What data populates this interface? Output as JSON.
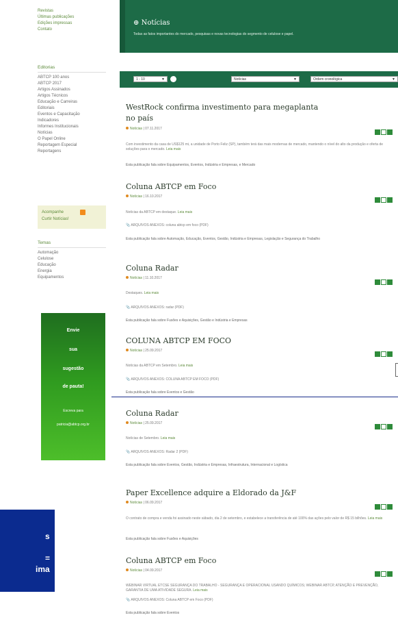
{
  "sidebar": {
    "top_links": [
      "Revistas",
      "Últimas publicações",
      "Edições impressas",
      "Contato"
    ],
    "editorias_title": "Editorias",
    "editorias": [
      "ABTCP 100 anos",
      "ABTCP 2017",
      "Artigos Assinados",
      "Artigos Técnicos",
      "Educação e Carreiras",
      "Editoriais",
      "Eventos e Capacitação",
      "Indicadores",
      "Informes Institucionais",
      "Notícias",
      "O Papel Online",
      "Reportagem Especial",
      "Reportagens"
    ],
    "follow_line1": "Acompanhe",
    "follow_line2": "Curtir Notícias!",
    "temas_title": "Temas",
    "temas": [
      "Automação",
      "Celulose",
      "Educação",
      "Energia",
      "Equipamentos"
    ]
  },
  "promo": {
    "line1": "Envie",
    "line2": "sua",
    "line3": "sugestão",
    "line4": "de pauta!",
    "small1": "Escreva para",
    "small2": "patricia@abtcp.org.br"
  },
  "blue_box": {
    "t1": "s",
    "t2": "=",
    "t3": "ima"
  },
  "header": {
    "title": "Notícias",
    "desc": "Todas as fatos importantes do mercado, pesquisas e novas tecnologias do segmento de celulose e papel."
  },
  "filters": {
    "per_page": "1 - 10",
    "category": "Notícias",
    "order": "Ordem cronológica"
  },
  "colors": {
    "header_bg": "#1d6b47",
    "accent": "#5c8a3a",
    "promo": "#2f9a1f",
    "blue": "#0b2b8f"
  },
  "posts": [
    {
      "title1": "WestRock confirma investimento para megaplanta",
      "title2": "no país",
      "category": "Notícias",
      "date": "| 07.11.2017",
      "body": "Com investimento da casa de US$125 mi, a unidade de Porto Feliz (SP), também terá das mais modernas de mercado, mantendo o nível do alto da produção e oferta de soluções para o mercado.",
      "more": "Leia mais",
      "tags": "Esta publicação fala sobre Equipamentos, Eventos, Indústria e Empresas, e Mercado"
    },
    {
      "title1": "Coluna ABTCP em Foco",
      "category": "Notícias",
      "date": "| 16.10.2017",
      "body": "Notícias da ABTCP em destaque.",
      "more": "Leia mais",
      "attach": "ARQUIVOS ANEXOS: coluna abtcp em foco (PDF)",
      "tags": "Esta publicação fala sobre Automação, Educação, Eventos, Gestão, Indústria e Empresas, Legislação e Segurança do Trabalho"
    },
    {
      "title1": "Coluna Radar",
      "category": "Notícias",
      "date": "| 11.10.2017",
      "body": "Destaques.",
      "more": "Leia mais",
      "attach": "ARQUIVOS ANEXOS: radar (PDF)",
      "tags": "Esta publicação fala sobre Fusões e Aquisições, Gestão e Indústria e Empresas"
    },
    {
      "title1": "COLUNA ABTCP EM FOCO",
      "category": "Notícias",
      "date": "| 25.09.2017",
      "body": "Notícias da ABTCP em Setembro.",
      "more": "Leia mais",
      "attach": "ARQUIVOS ANEXOS: COLUNA ABTCP EM FOCO (PDF)",
      "tags": "Esta publicação fala sobre Eventos e Gestão"
    },
    {
      "title1": "Coluna Radar",
      "category": "Notícias",
      "date": "| 25.09.2017",
      "body": "Notícias de Setembro.",
      "more": "Leia mais",
      "attach": "ARQUIVOS ANEXOS: Radar 2 (PDF)",
      "tags": "Esta publicação fala sobre Eventos, Gestão, Indústria e Empresas, Infraestrutura, Internacional e Logística"
    },
    {
      "title1": "Paper Excellence adquire a Eldorado da J&F",
      "category": "Notícias",
      "date": "| 06.09.2017",
      "body": "O contrato de compra e venda foi assinado neste sábado, dia 2 de setembro, e estabelece a transferência de até 100% das ações pelo valor de R$ 15 bilhões.",
      "more": "Leia mais",
      "tags": "Esta publicação fala sobre Fusões e Aquisições"
    },
    {
      "title1": "Coluna ABTCP em Foco",
      "category": "Notícias",
      "date": "| 04.09.2017",
      "body": "WEBINAR VIRTUAL ETCSE SEGURANÇA DO TRABALHO - SEGURANÇA E OPERACIONAL USANDO QUÍMICOS; WEBINAR ABTCP, ATENÇÃO E PREVENÇÃO, GARANTIA DE UMA ATIVIDADE SEGURA.",
      "more": "Leia mais",
      "attach": "ARQUIVOS ANEXOS: Coluna ABTCP em Foco (PDF)",
      "tags": "Esta publicação fala sobre Eventos"
    }
  ]
}
